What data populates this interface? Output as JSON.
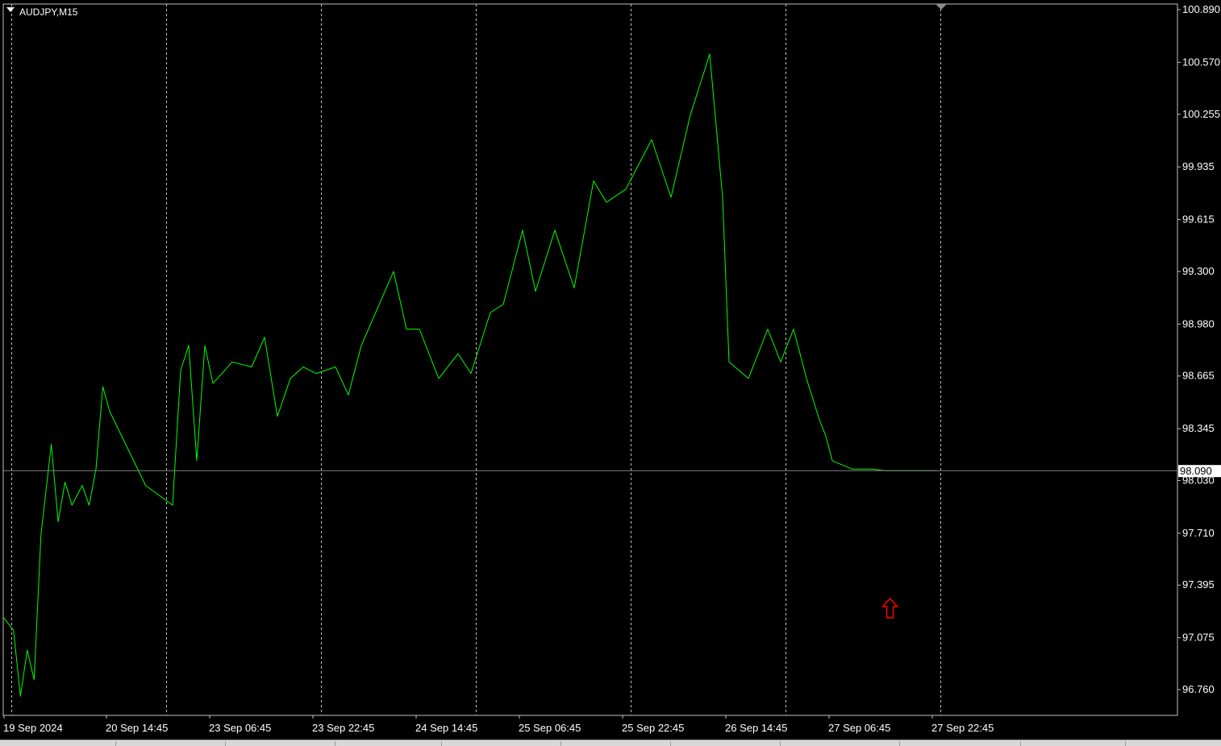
{
  "window": {
    "symbol_label": "AUDJPY,M15"
  },
  "colors": {
    "background": "#000000",
    "grid": "#c0c0c0",
    "price_line": "#00ff00",
    "axis_text": "#ffffff",
    "current_price_line": "#808080",
    "arrow": "#ff0000"
  },
  "current_price": {
    "value": 98.09,
    "label": "98.090"
  },
  "arrow_marker": {
    "icon": "red-up-arrow-icon",
    "time": "27 Sep 15:30",
    "price": 97.25
  },
  "chart_data": {
    "type": "line",
    "symbol": "AUDJPY",
    "timeframe": "M15",
    "ylim": [
      96.6,
      100.89
    ],
    "y_ticks": [
      "100.890",
      "100.570",
      "100.255",
      "99.935",
      "99.615",
      "99.300",
      "98.980",
      "98.665",
      "98.345",
      "98.030",
      "97.710",
      "97.395",
      "97.075",
      "96.760"
    ],
    "x_ticks": [
      "19 Sep 2024",
      "20 Sep 14:45",
      "23 Sep 06:45",
      "23 Sep 22:45",
      "24 Sep 14:45",
      "25 Sep 06:45",
      "25 Sep 22:45",
      "26 Sep 14:45",
      "27 Sep 06:45",
      "27 Sep 22:45"
    ],
    "grid": "vertical dashed at each x tick",
    "series": [
      {
        "x": [
          "19 Sep 07:45",
          "19 Sep 10:45",
          "19 Sep 12:45",
          "19 Sep 14:45",
          "19 Sep 16:45",
          "19 Sep 18:45",
          "19 Sep 21:45",
          "19 Sep 23:45",
          "20 Sep 01:45",
          "20 Sep 03:45",
          "20 Sep 06:45",
          "20 Sep 08:45",
          "20 Sep 10:45",
          "20 Sep 12:45",
          "20 Sep 14:45",
          "20 Sep 18:45",
          "20 Sep 21:45",
          "22 Sep 22:45",
          "23 Sep 00:45",
          "23 Sep 02:45",
          "23 Sep 04:45",
          "23 Sep 06:45",
          "23 Sep 09:45",
          "23 Sep 12:45",
          "23 Sep 14:45",
          "23 Sep 16:45",
          "23 Sep 18:45",
          "23 Sep 20:45",
          "23 Sep 22:45",
          "24 Sep 01:45",
          "24 Sep 03:45",
          "24 Sep 05:45",
          "24 Sep 08:45",
          "24 Sep 10:45",
          "24 Sep 12:45",
          "24 Sep 14:45",
          "24 Sep 17:45",
          "24 Sep 20:45",
          "24 Sep 22:45",
          "25 Sep 01:45",
          "25 Sep 03:45",
          "25 Sep 06:45",
          "25 Sep 08:45",
          "25 Sep 11:45",
          "25 Sep 14:45",
          "25 Sep 17:45",
          "25 Sep 19:45",
          "25 Sep 22:45",
          "26 Sep 00:45",
          "26 Sep 02:45",
          "26 Sep 05:45",
          "26 Sep 08:45",
          "26 Sep 11:45",
          "26 Sep 13:45",
          "26 Sep 14:45",
          "26 Sep 17:45",
          "26 Sep 20:45",
          "26 Sep 22:45",
          "27 Sep 00:45",
          "27 Sep 02:45",
          "27 Sep 04:45",
          "27 Sep 05:45",
          "27 Sep 06:45",
          "27 Sep 09:45",
          "27 Sep 12:45",
          "27 Sep 14:45",
          "27 Sep 17:45",
          "27 Sep 20:45",
          "27 Sep 22:45"
        ],
        "y": [
          97.2,
          97.12,
          96.72,
          97.0,
          96.82,
          97.7,
          98.25,
          97.78,
          98.02,
          97.88,
          98.0,
          97.88,
          98.1,
          98.6,
          98.45,
          98.0,
          97.88,
          98.7,
          98.85,
          98.15,
          98.85,
          98.62,
          98.75,
          98.72,
          98.9,
          98.42,
          98.65,
          98.72,
          98.68,
          98.72,
          98.55,
          98.85,
          99.12,
          99.3,
          98.95,
          98.95,
          98.65,
          98.8,
          98.68,
          99.05,
          99.1,
          99.55,
          99.18,
          99.55,
          99.2,
          99.85,
          99.72,
          99.8,
          99.95,
          100.1,
          99.75,
          100.25,
          100.62,
          99.75,
          98.75,
          98.65,
          98.95,
          98.75,
          98.95,
          98.65,
          98.4,
          98.3,
          98.15,
          98.1,
          98.1,
          98.09,
          98.09,
          98.09,
          98.09
        ]
      }
    ]
  }
}
